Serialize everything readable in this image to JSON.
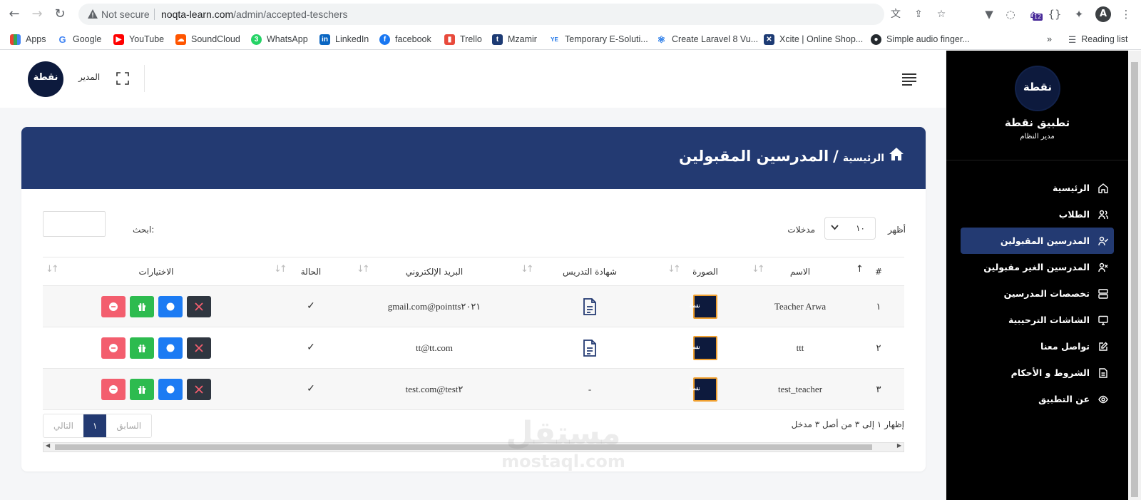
{
  "browser": {
    "not_secure": "Not secure",
    "url_host": "noqta-learn.com",
    "url_path": "/admin/accepted-teschers",
    "extension_badge": "12",
    "profile_initial": "A",
    "reading_list": "Reading list",
    "bookmarks": [
      {
        "label": "Apps",
        "icon": "apps-grid-icon"
      },
      {
        "label": "Google",
        "icon": "google-icon"
      },
      {
        "label": "YouTube",
        "icon": "youtube-icon"
      },
      {
        "label": "SoundCloud",
        "icon": "soundcloud-icon"
      },
      {
        "label": "WhatsApp",
        "icon": "whatsapp-icon"
      },
      {
        "label": "LinkedIn",
        "icon": "linkedin-icon"
      },
      {
        "label": "facebook",
        "icon": "facebook-icon"
      },
      {
        "label": "Trello",
        "icon": "trello-icon"
      },
      {
        "label": "Mzamir",
        "icon": "mzamir-icon"
      },
      {
        "label": "Temporary E-Soluti...",
        "icon": "esolution-icon"
      },
      {
        "label": "Create Laravel 8 Vu...",
        "icon": "react-icon"
      },
      {
        "label": "Xcite | Online Shop...",
        "icon": "xcite-icon"
      },
      {
        "label": "Simple audio finger...",
        "icon": "github-icon"
      }
    ]
  },
  "topbar": {
    "admin_label": "المدير",
    "logo_text": "نقطة"
  },
  "header": {
    "home_crumb": "الرئيسية",
    "separator": "/",
    "page_title": "المدرسين المقبولين"
  },
  "controls": {
    "show_label": "أظهر",
    "entries_value": "١٠",
    "entries_label": "مدخلات",
    "search_label": "ابحث:"
  },
  "table": {
    "columns": [
      "#",
      "الاسم",
      "الصورة",
      "شهادة التدريس",
      "البريد الإلكتروني",
      "الحالة",
      "الاختيارات"
    ],
    "rows": [
      {
        "index": "١",
        "name": "Teacher Arwa",
        "has_certificate": true,
        "certificate": "",
        "email": "pointts٢٠٢١@gmail.com",
        "status": "✓"
      },
      {
        "index": "٢",
        "name": "ttt",
        "has_certificate": true,
        "certificate": "",
        "email": "tt@tt.com",
        "status": "✓"
      },
      {
        "index": "٣",
        "name": "test_teacher",
        "has_certificate": false,
        "certificate": "-",
        "email": "test٢@test.com",
        "status": "✓"
      }
    ]
  },
  "pagination": {
    "info": "إظهار ١ إلى ٣ من أصل ٣ مدخل",
    "prev": "السابق",
    "current": "١",
    "next": "التالي"
  },
  "sidebar": {
    "logo_text": "نقطة",
    "app_name": "تطبيق نقطة",
    "role": "مدير النظام",
    "items": [
      {
        "label": "الرئيسية",
        "icon": "home-icon",
        "active": false
      },
      {
        "label": "الطلاب",
        "icon": "users-icon",
        "active": false
      },
      {
        "label": "المدرسين المقبولين",
        "icon": "user-check-icon",
        "active": true
      },
      {
        "label": "المدرسين الغير مقبولين",
        "icon": "user-x-icon",
        "active": false
      },
      {
        "label": "تخصصات المدرسين",
        "icon": "server-icon",
        "active": false
      },
      {
        "label": "الشاشات الترحيبية",
        "icon": "monitor-icon",
        "active": false
      },
      {
        "label": "تواصل معنا",
        "icon": "edit-icon",
        "active": false
      },
      {
        "label": "الشروط و الأحكام",
        "icon": "file-icon",
        "active": false
      },
      {
        "label": "عن التطبيق",
        "icon": "eye-icon",
        "active": false
      }
    ]
  },
  "watermark": {
    "arabic": "مستقل",
    "latin": "mostaql.com"
  },
  "colors": {
    "header_blue": "#233a72",
    "sidebar_bg": "#000000",
    "delete_red": "#f35e6e",
    "gift_green": "#2dbb4f",
    "action_blue": "#1c7bf3",
    "close_dark": "#2f3640",
    "thumb_border": "#f0a030"
  }
}
